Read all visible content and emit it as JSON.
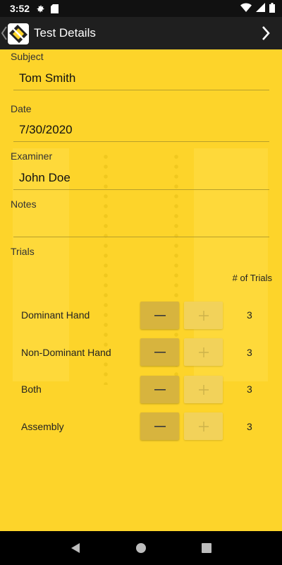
{
  "status": {
    "time": "3:52",
    "icons": [
      "gear-icon",
      "sd-card-icon",
      "wifi-icon",
      "signal-icon",
      "battery-icon"
    ]
  },
  "header": {
    "title": "Test Details",
    "logo_icon": "app-logo-icon",
    "next_icon": "chevron-right-icon",
    "back_icon": "chevron-left-icon"
  },
  "form": {
    "subject": {
      "label": "Subject",
      "value": "Tom Smith"
    },
    "date": {
      "label": "Date",
      "value": "7/30/2020"
    },
    "examiner": {
      "label": "Examiner",
      "value": "John Doe"
    },
    "notes": {
      "label": "Notes",
      "value": ""
    }
  },
  "trials": {
    "section_label": "Trials",
    "count_header": "# of Trials",
    "rows": [
      {
        "label": "Dominant Hand",
        "count": "3"
      },
      {
        "label": "Non-Dominant Hand",
        "count": "3"
      },
      {
        "label": "Both",
        "count": "3"
      },
      {
        "label": "Assembly",
        "count": "3"
      }
    ]
  },
  "colors": {
    "background": "#fdd42a",
    "app_bar": "#1f1f1f",
    "minus_button": "#d7b43e",
    "plus_button": "#f2d25a"
  },
  "nav": {
    "icons": [
      "back-triangle-icon",
      "home-circle-icon",
      "recents-square-icon"
    ]
  }
}
